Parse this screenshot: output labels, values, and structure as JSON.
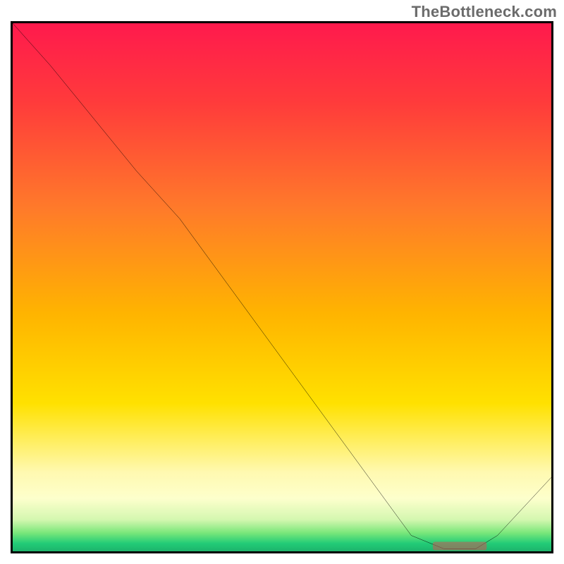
{
  "brand": {
    "watermark": "TheBottleneck.com",
    "site_color": "#6b6b6b"
  },
  "gradient": {
    "stops": [
      {
        "offset": 0.0,
        "color": "#ff1a4d"
      },
      {
        "offset": 0.15,
        "color": "#ff3b3b"
      },
      {
        "offset": 0.35,
        "color": "#ff7a2a"
      },
      {
        "offset": 0.55,
        "color": "#ffb400"
      },
      {
        "offset": 0.72,
        "color": "#ffe100"
      },
      {
        "offset": 0.85,
        "color": "#fff9b0"
      },
      {
        "offset": 0.9,
        "color": "#fdffcc"
      },
      {
        "offset": 0.94,
        "color": "#d4f7b0"
      },
      {
        "offset": 0.965,
        "color": "#7ae77a"
      },
      {
        "offset": 0.985,
        "color": "#22cc77"
      },
      {
        "offset": 1.0,
        "color": "#1db36b"
      }
    ]
  },
  "chart_data": {
    "type": "line",
    "title": "",
    "xlabel": "",
    "ylabel": "",
    "x": [
      0,
      7,
      23,
      31,
      74,
      80,
      86,
      90,
      100
    ],
    "values": [
      100,
      92,
      72,
      63,
      3,
      0.5,
      0.5,
      3,
      14
    ],
    "xlim": [
      0,
      100
    ],
    "ylim": [
      0,
      100
    ],
    "best_zone": {
      "x_start": 78,
      "x_end": 88,
      "label": ""
    },
    "grid": false,
    "legend": false
  },
  "zone_label": ""
}
